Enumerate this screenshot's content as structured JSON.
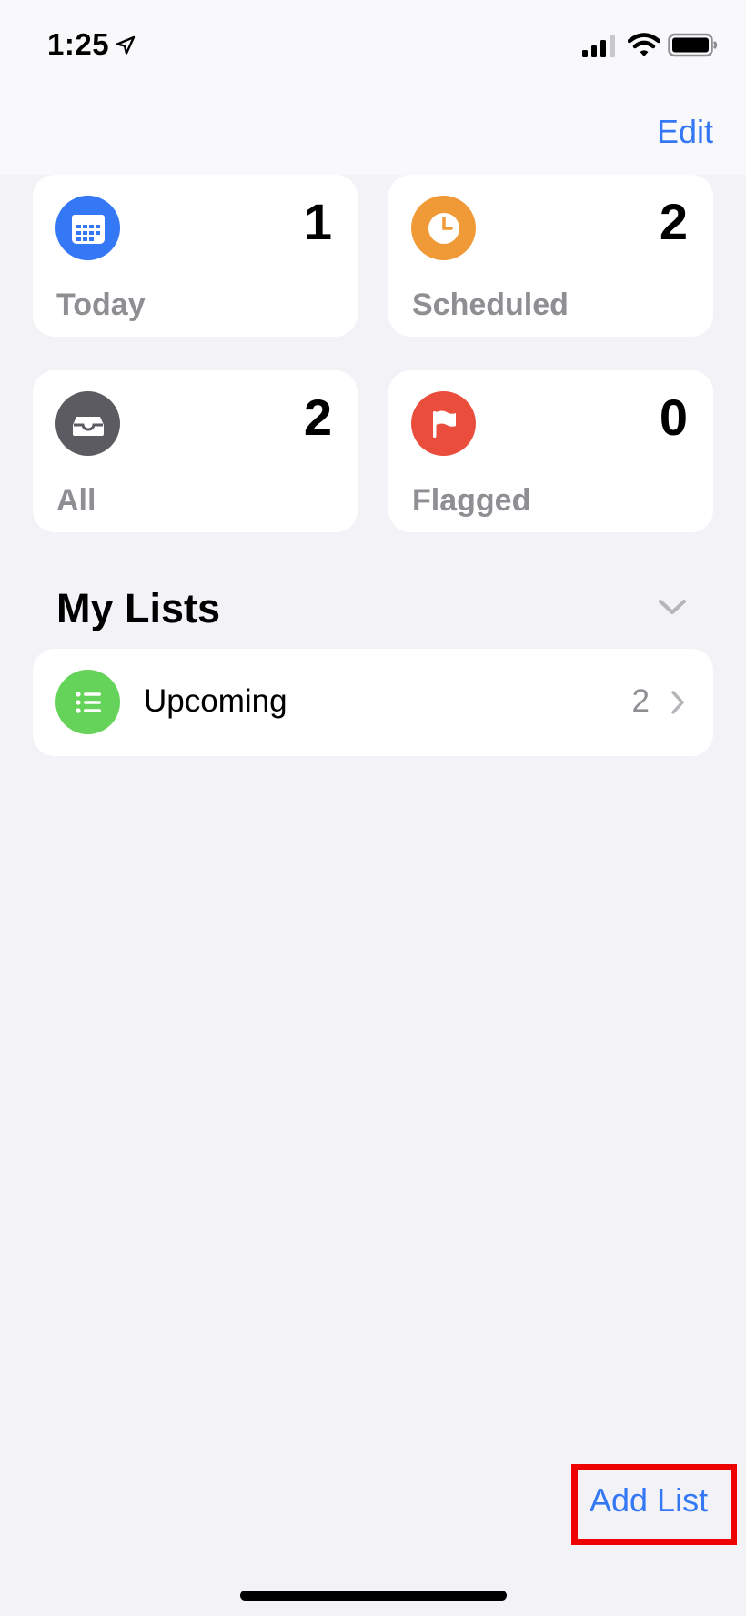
{
  "status_bar": {
    "time": "1:25"
  },
  "nav": {
    "edit_label": "Edit"
  },
  "smart_lists": [
    {
      "label": "Today",
      "count": "1",
      "icon": "calendar-icon",
      "color": "#3478f6"
    },
    {
      "label": "Scheduled",
      "count": "2",
      "icon": "clock-icon",
      "color": "#f09a37"
    },
    {
      "label": "All",
      "count": "2",
      "icon": "tray-icon",
      "color": "#5b5b61"
    },
    {
      "label": "Flagged",
      "count": "0",
      "icon": "flag-icon",
      "color": "#eb4d3d"
    }
  ],
  "my_lists": {
    "title": "My Lists",
    "items": [
      {
        "name": "Upcoming",
        "count": "2",
        "icon": "list-bullet-icon",
        "color": "#65d35a"
      }
    ]
  },
  "toolbar": {
    "add_list_label": "Add List"
  },
  "colors": {
    "accent": "#3478f6",
    "highlight": "#ee0000",
    "background": "#f2f2f7"
  }
}
